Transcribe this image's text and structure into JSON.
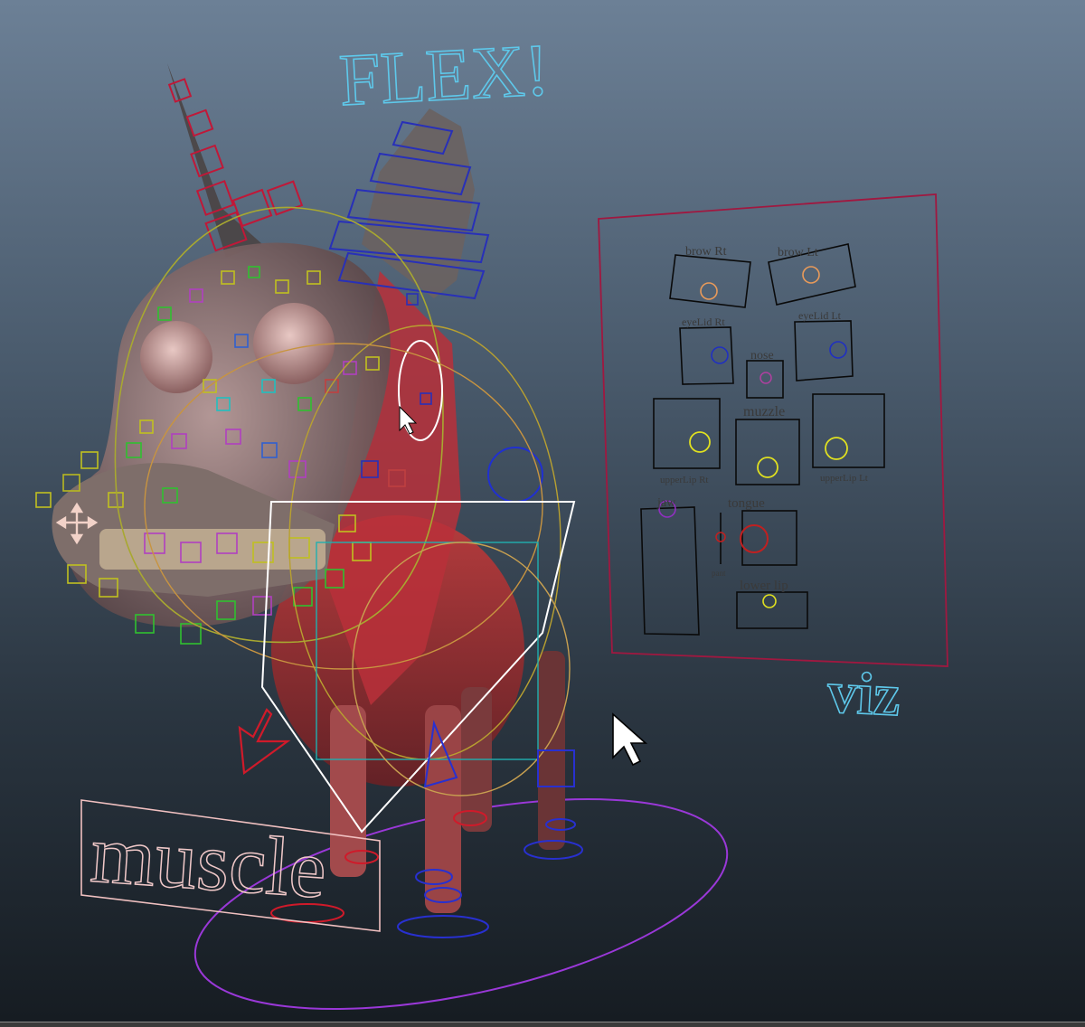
{
  "viewport": {
    "labels": {
      "flex": "FLEX!",
      "viz": "viz",
      "muscle": "muscle"
    }
  },
  "face_panel": {
    "brow_rt": "brow Rt",
    "brow_lt": "brow Lt",
    "eyelid_rt": "eyeLid Rt",
    "eyelid_lt": "eyeLid Lt",
    "nose": "nose",
    "muzzle": "muzzle",
    "upperlip_rt": "upperLip Rt",
    "upperlip_lt": "upperLip Lt",
    "jaw": "jaw",
    "tongue": "tongue",
    "pant": "pant",
    "lower_lip": "lower lip"
  },
  "colors": {
    "viewport_top": "#6c8096",
    "viewport_bottom": "#161c22",
    "flex_label": "#5ec8ea",
    "viz_label": "#5ec8ea",
    "muscle_label": "#f0c8c8",
    "panel_frame": "#a01840",
    "control_box": "#0a0a0a",
    "brow_circle": "#e89a5a",
    "eyelid_circle": "#2030c0",
    "nose_circle": "#b040a0",
    "muzzle_circle": "#e0e020",
    "jaw_circle": "#9030c0",
    "tongue_circle": "#c02020",
    "ground_circle": "#9a38d8",
    "ear_rig_blue": "#2830b8",
    "ear_rig_red": "#c01838"
  },
  "icons": [
    "move-manipulator-icon",
    "mouse-pointer-icon"
  ]
}
